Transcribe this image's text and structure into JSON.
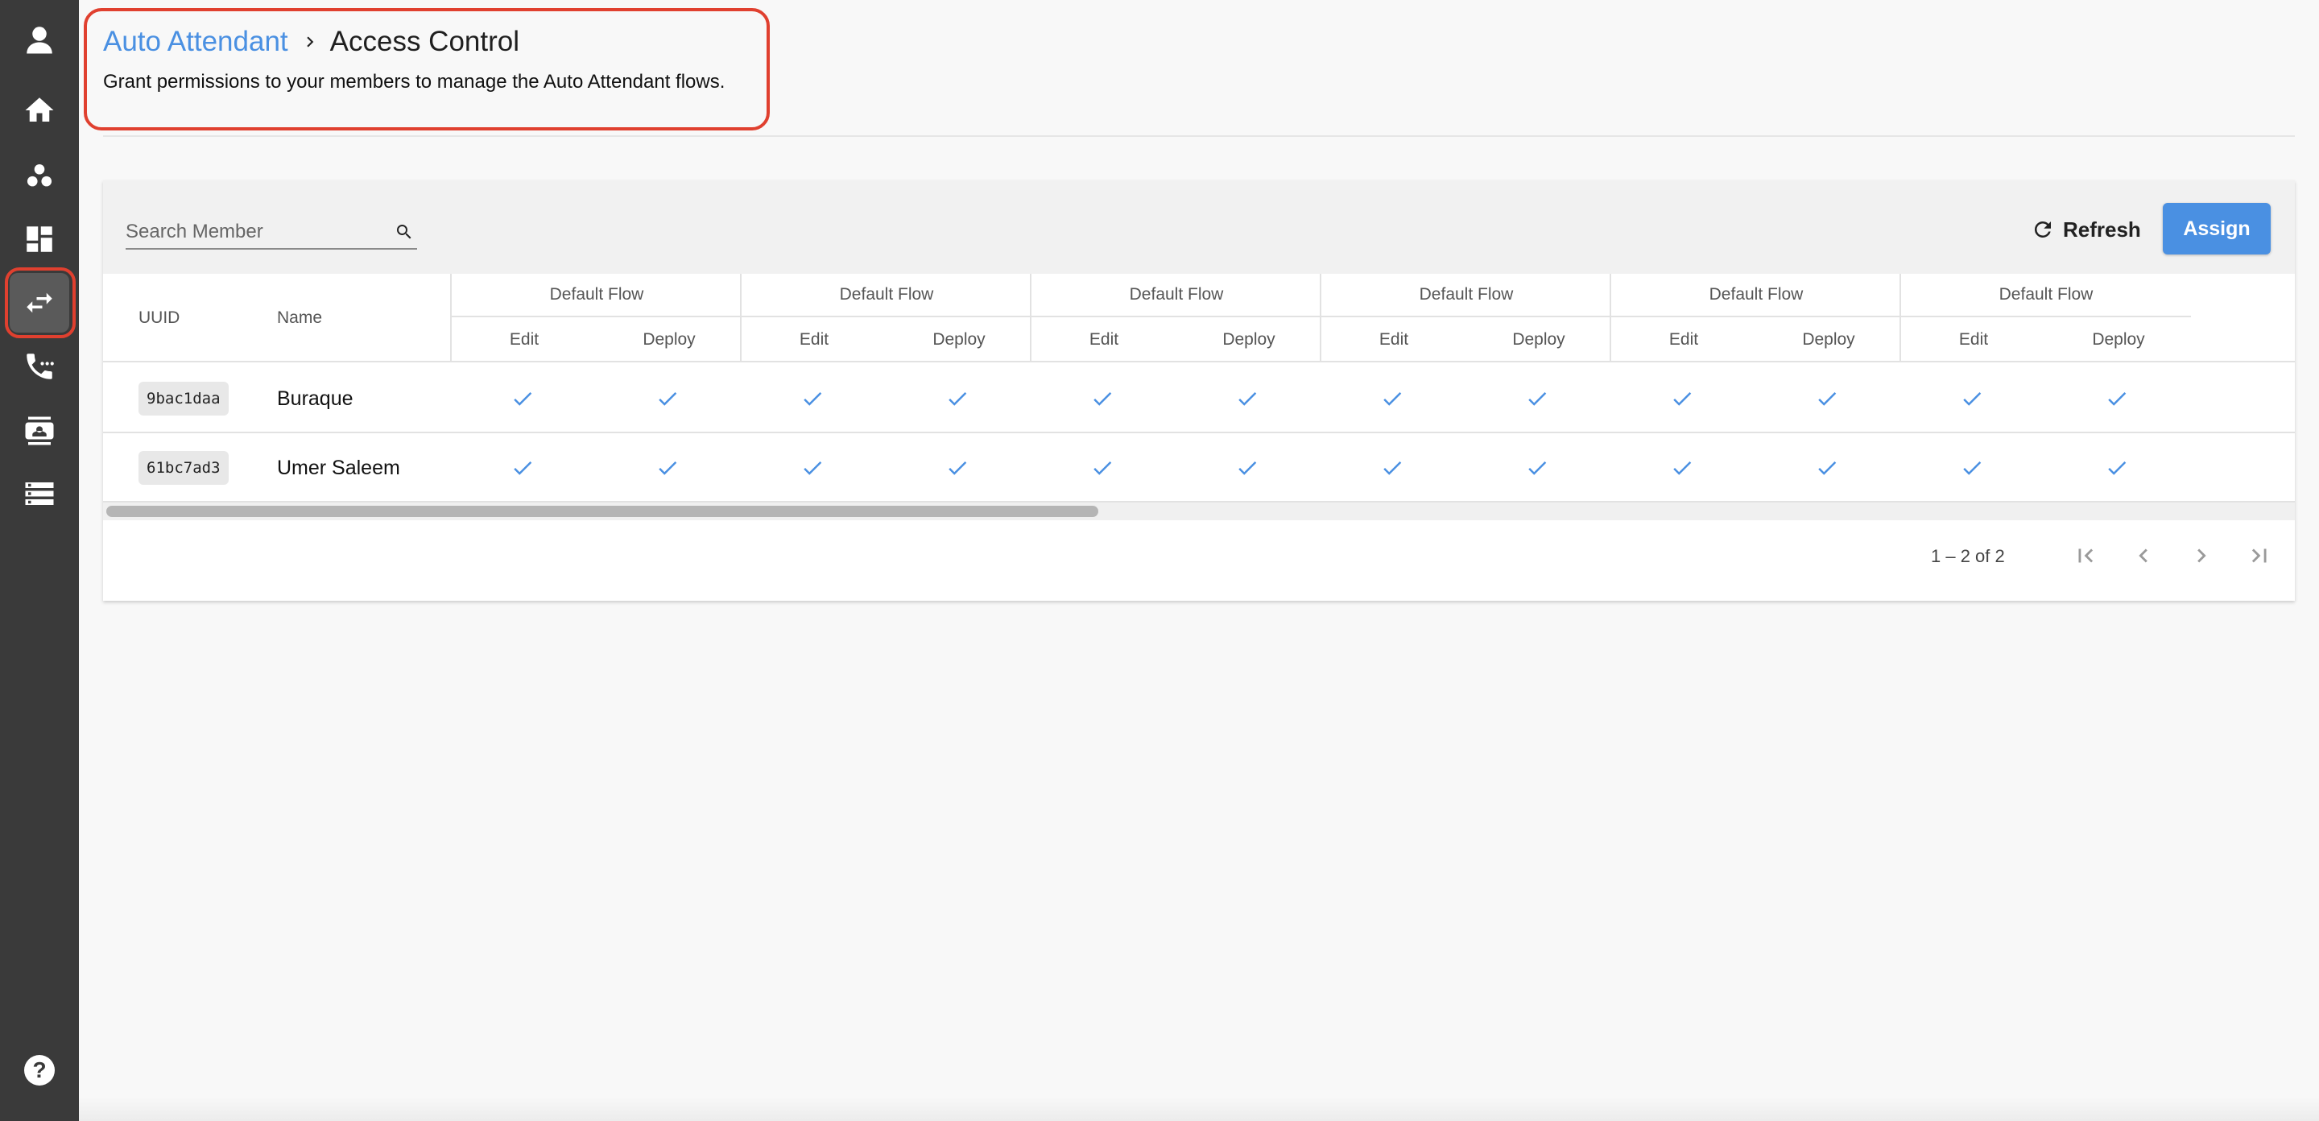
{
  "sidebar": {
    "items": [
      {
        "icon": "account-icon"
      },
      {
        "icon": "home-icon"
      },
      {
        "icon": "group-icon"
      },
      {
        "icon": "dashboard-icon"
      },
      {
        "icon": "swap-horiz-icon",
        "active": true
      },
      {
        "icon": "phone-forwarded-icon"
      },
      {
        "icon": "contact-card-icon"
      },
      {
        "icon": "storage-icon"
      }
    ],
    "help_icon": "help-icon",
    "help_label": "?"
  },
  "breadcrumb": {
    "parent": "Auto Attendant",
    "current": "Access Control"
  },
  "subtitle": "Grant permissions to your members to manage the Auto Attendant flows.",
  "toolbar": {
    "search_placeholder": "Search Member",
    "refresh_label": "Refresh",
    "assign_label": "Assign"
  },
  "table": {
    "columns": {
      "uuid": "UUID",
      "name": "Name"
    },
    "groups": [
      {
        "title": "Default Flow",
        "sub": [
          "Edit",
          "Deploy"
        ]
      },
      {
        "title": "Default Flow",
        "sub": [
          "Edit",
          "Deploy"
        ]
      },
      {
        "title": "Default Flow",
        "sub": [
          "Edit",
          "Deploy"
        ]
      },
      {
        "title": "Default Flow",
        "sub": [
          "Edit",
          "Deploy"
        ]
      },
      {
        "title": "Default Flow",
        "sub": [
          "Edit",
          "Deploy"
        ]
      },
      {
        "title": "Default Flow",
        "sub": [
          "Edit",
          "Deploy"
        ]
      }
    ],
    "rows": [
      {
        "uuid": "9bac1daa",
        "name": "Buraque",
        "perms": [
          true,
          true,
          true,
          true,
          true,
          true,
          true,
          true,
          true,
          true,
          true,
          true
        ]
      },
      {
        "uuid": "61bc7ad3",
        "name": "Umer Saleem",
        "perms": [
          true,
          true,
          true,
          true,
          true,
          true,
          true,
          true,
          true,
          true,
          true,
          true
        ]
      }
    ]
  },
  "paginator": {
    "range": "1 – 2 of 2"
  },
  "colors": {
    "accent": "#4a90e2",
    "highlight": "#e0402f",
    "sidebar": "#3a3a3a"
  }
}
